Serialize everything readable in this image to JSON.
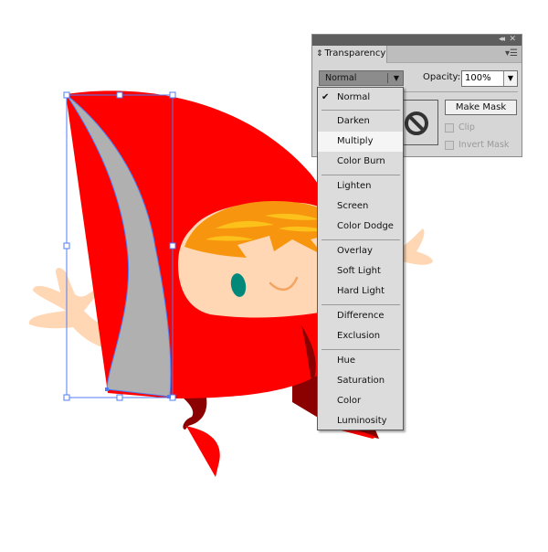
{
  "panel": {
    "title": "Transparency",
    "tab_icon": "updown-arrows-icon",
    "blend_mode": "Normal",
    "opacity_label": "Opacity:",
    "opacity_value": "100%",
    "make_mask_label": "Make Mask",
    "clip_label": "Clip",
    "invert_mask_label": "Invert Mask",
    "clip_checked": false,
    "invert_mask_checked": false
  },
  "blend_menu": {
    "selected": "Normal",
    "hovered": "Multiply",
    "groups": [
      [
        "Normal"
      ],
      [
        "Darken",
        "Multiply",
        "Color Burn"
      ],
      [
        "Lighten",
        "Screen",
        "Color Dodge"
      ],
      [
        "Overlay",
        "Soft Light",
        "Hard Light"
      ],
      [
        "Difference",
        "Exclusion"
      ],
      [
        "Hue",
        "Saturation",
        "Color",
        "Luminosity"
      ]
    ],
    "items": [
      {
        "label": "Normal"
      },
      {
        "label": "Darken"
      },
      {
        "label": "Multiply"
      },
      {
        "label": "Color Burn"
      },
      {
        "label": "Lighten"
      },
      {
        "label": "Screen"
      },
      {
        "label": "Color Dodge"
      },
      {
        "label": "Overlay"
      },
      {
        "label": "Soft Light"
      },
      {
        "label": "Hard Light"
      },
      {
        "label": "Difference"
      },
      {
        "label": "Exclusion"
      },
      {
        "label": "Hue"
      },
      {
        "label": "Saturation"
      },
      {
        "label": "Color"
      },
      {
        "label": "Luminosity"
      }
    ]
  },
  "colors": {
    "hood_red": "#ff0000",
    "dark_red": "#8b0000",
    "skin": "#ffd7b5",
    "hair_orange": "#f7960e",
    "hair_highlight": "#fcc21b",
    "eye_teal": "#00897b",
    "smile": "#f4a460",
    "selected_shape_gray": "#b0b0b0",
    "selection_blue": "#4f7df5"
  }
}
